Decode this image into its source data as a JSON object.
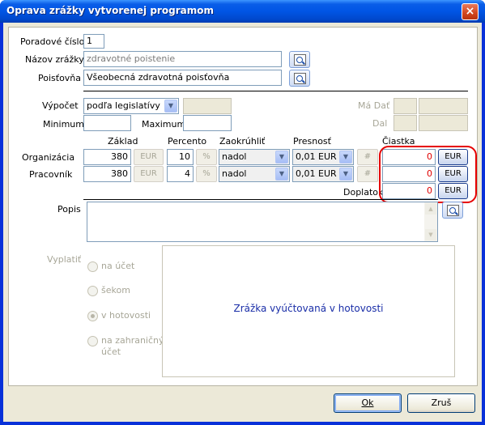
{
  "window": {
    "title": "Oprava zrážky vytvorenej programom",
    "close": "×"
  },
  "form": {
    "poradove_label": "Poradové číslo",
    "poradove_value": "1",
    "nazov_label": "Názov zrážky",
    "nazov_value": "zdravotné poistenie",
    "poistovna_label": "Poisťovňa",
    "poistovna_value": "Všeobecná zdravotná poisťovňa"
  },
  "calc": {
    "vypocet_label": "Výpočet",
    "vypocet_value": "podľa legislatívy",
    "minimum_label": "Minimum",
    "maximum_label": "Maximum",
    "ma_dat_label": "Má Dať",
    "dal_label": "Dal"
  },
  "table": {
    "headers": {
      "zaklad": "Základ",
      "percento": "Percento",
      "zaokruhlit": "Zaokrúhliť",
      "presnost": "Presnosť",
      "ciastka": "Čiastka"
    },
    "rows": [
      {
        "label": "Organizácia",
        "zaklad": "380",
        "zaklad_unit": "EUR",
        "percento": "10",
        "pct_unit": "%",
        "zaokruhlit": "nadol",
        "presnost": "0,01 EUR",
        "hash": "#",
        "ciastka": "0",
        "ciastka_unit": "EUR"
      },
      {
        "label": "Pracovník",
        "zaklad": "380",
        "zaklad_unit": "EUR",
        "percento": "4",
        "pct_unit": "%",
        "zaokruhlit": "nadol",
        "presnost": "0,01 EUR",
        "hash": "#",
        "ciastka": "0",
        "ciastka_unit": "EUR"
      }
    ],
    "doplatok_label": "Doplatok",
    "doplatok_value": "0",
    "doplatok_unit": "EUR"
  },
  "popis_label": "Popis",
  "vyplatit": {
    "label": "Vyplatiť",
    "options": [
      "na účet",
      "šekom",
      "v hotovosti",
      "na zahraničný účet"
    ],
    "selected": "v hotovosti",
    "message": "Zrážka vyúčtovaná v hotovosti"
  },
  "buttons": {
    "ok": "Ok",
    "cancel": "Zruš"
  },
  "colors": {
    "amount_text": "#e00000",
    "highlight": "#e60000",
    "message": "#1a2ea8"
  }
}
